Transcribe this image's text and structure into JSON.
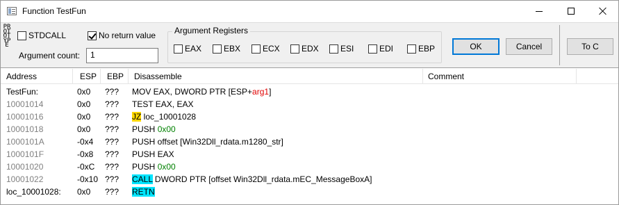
{
  "window": {
    "title": "Function TestFun",
    "icon": "window-app-icon"
  },
  "prototype_label": "PROTOTYPE",
  "stdcall": {
    "label": "STDCALL",
    "checked": false
  },
  "no_return": {
    "label": "No return value",
    "checked": true
  },
  "arg_count": {
    "label": "Argument count:",
    "value": "1"
  },
  "arg_registers": {
    "title": "Argument Registers",
    "registers": [
      "EAX",
      "EBX",
      "ECX",
      "EDX",
      "ESI",
      "EDI",
      "EBP"
    ]
  },
  "buttons": {
    "ok": "OK",
    "cancel": "Cancel",
    "to_c": "To C"
  },
  "columns": [
    "Address",
    "ESP",
    "EBP",
    "Disassemble",
    "Comment"
  ],
  "rows": [
    {
      "address": "TestFun:",
      "label_row": true,
      "esp": "0x0",
      "ebp": "???",
      "text": "MOV EAX, DWORD PTR [ESP+",
      "arg": "arg1",
      "after": "]"
    },
    {
      "address": "10001014",
      "esp": "0x0",
      "ebp": "???",
      "text": "TEST EAX, EAX"
    },
    {
      "address": "10001016",
      "esp": "0x0",
      "ebp": "???",
      "mnemonic": "JZ",
      "operand": " loc_10001028"
    },
    {
      "address": "10001018",
      "esp": "0x0",
      "ebp": "???",
      "text": "PUSH ",
      "imm": "0x00"
    },
    {
      "address": "1000101A",
      "esp": "-0x4",
      "ebp": "???",
      "text": "PUSH offset [Win32Dll_rdata.m1280_str]"
    },
    {
      "address": "1000101F",
      "esp": "-0x8",
      "ebp": "???",
      "text": "PUSH EAX"
    },
    {
      "address": "10001020",
      "esp": "-0xC",
      "ebp": "???",
      "text": "PUSH ",
      "imm": "0x00"
    },
    {
      "address": "10001022",
      "esp": "-0x10",
      "ebp": "???",
      "mnemonic": "CALL",
      "operand": " DWORD PTR [offset Win32Dll_rdata.mEC_MessageBoxA]"
    },
    {
      "address": "loc_10001028:",
      "label_row": true,
      "esp": "0x0",
      "ebp": "???",
      "mnemonic": "RETN",
      "operand": ""
    }
  ],
  "colors": {
    "jump_highlight": "#ffd700",
    "call_highlight": "#00e5ff",
    "argument": "#e00000",
    "immediate": "#008000",
    "address_gray": "#808080",
    "default_button_border": "#0078d7"
  }
}
